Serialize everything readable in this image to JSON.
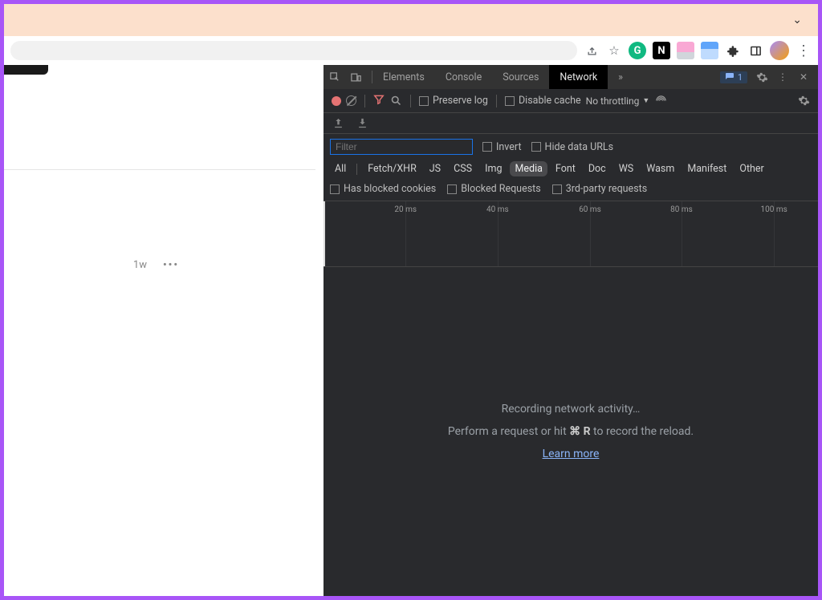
{
  "banner": {},
  "page": {
    "timestamp": "1w"
  },
  "devtools": {
    "tabs": [
      "Elements",
      "Console",
      "Sources",
      "Network"
    ],
    "active_tab": "Network",
    "issues_count": "1",
    "toolbar": {
      "preserve_log": "Preserve log",
      "disable_cache": "Disable cache",
      "throttling": "No throttling"
    },
    "filter": {
      "placeholder": "Filter",
      "invert": "Invert",
      "hide_data_urls": "Hide data URLs"
    },
    "types": [
      "All",
      "Fetch/XHR",
      "JS",
      "CSS",
      "Img",
      "Media",
      "Font",
      "Doc",
      "WS",
      "Wasm",
      "Manifest",
      "Other"
    ],
    "selected_type": "Media",
    "checkboxes": {
      "blocked_cookies": "Has blocked cookies",
      "blocked_requests": "Blocked Requests",
      "third_party": "3rd-party requests"
    },
    "timeline_ticks": [
      "20 ms",
      "40 ms",
      "60 ms",
      "80 ms",
      "100 ms"
    ],
    "empty": {
      "line1": "Recording network activity…",
      "line2a": "Perform a request or hit ",
      "line2_key": "⌘ R",
      "line2b": " to record the reload.",
      "learn": "Learn more"
    }
  }
}
